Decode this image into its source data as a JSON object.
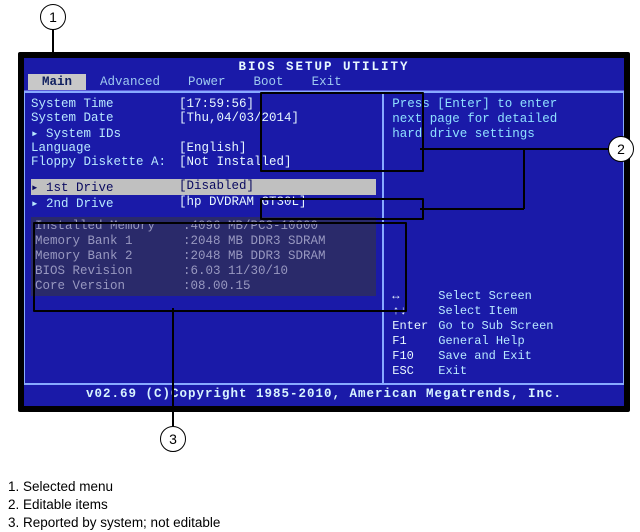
{
  "title": "BIOS SETUP UTILITY",
  "menu": {
    "items": [
      "Main",
      "Advanced",
      "Power",
      "Boot",
      "Exit"
    ],
    "selected": 0
  },
  "fields": {
    "system_time": {
      "label": "System Time",
      "value": "[17:59:56]"
    },
    "system_date": {
      "label": "System Date",
      "value": "[Thu,04/03/2014]"
    },
    "system_ids": {
      "label": "▸ System IDs",
      "value": ""
    },
    "language": {
      "label": "Language",
      "value": "[English]"
    },
    "floppy_a": {
      "label": "Floppy Diskette A:",
      "value": "[Not Installed]"
    },
    "drive1": {
      "label": "▸ 1st Drive",
      "value": "[Disabled]"
    },
    "drive2": {
      "label": "▸ 2nd Drive",
      "value": "[hp DVDRAM GT30L]"
    }
  },
  "reported": {
    "inst_mem": {
      "label": "Installed Memory",
      "value": ":4096 MB/PC3-10600"
    },
    "bank1": {
      "label": "Memory Bank 1",
      "value": ":2048 MB DDR3 SDRAM"
    },
    "bank2": {
      "label": "Memory Bank 2",
      "value": ":2048 MB DDR3 SDRAM"
    },
    "bios_rev": {
      "label": "BIOS Revision",
      "value": ":6.03 11/30/10"
    },
    "core_ver": {
      "label": "Core Version",
      "value": ":08.00.15"
    }
  },
  "help": {
    "line1": "Press [Enter] to enter",
    "line2": "next page for detailed",
    "line3": "hard drive settings"
  },
  "keys": [
    {
      "k": "↔",
      "d": "Select Screen"
    },
    {
      "k": "↑↓",
      "d": "Select Item"
    },
    {
      "k": "Enter",
      "d": "Go to Sub Screen"
    },
    {
      "k": "F1",
      "d": "General Help"
    },
    {
      "k": "F10",
      "d": "Save and Exit"
    },
    {
      "k": "ESC",
      "d": "Exit"
    }
  ],
  "footer": "v02.69 (C)Copyright 1985-2010, American Megatrends, Inc.",
  "callouts": {
    "c1": "1",
    "c2": "2",
    "c3": "3"
  },
  "legend": {
    "l1": "1. Selected menu",
    "l2": "2. Editable items",
    "l3": "3. Reported by system; not editable"
  }
}
